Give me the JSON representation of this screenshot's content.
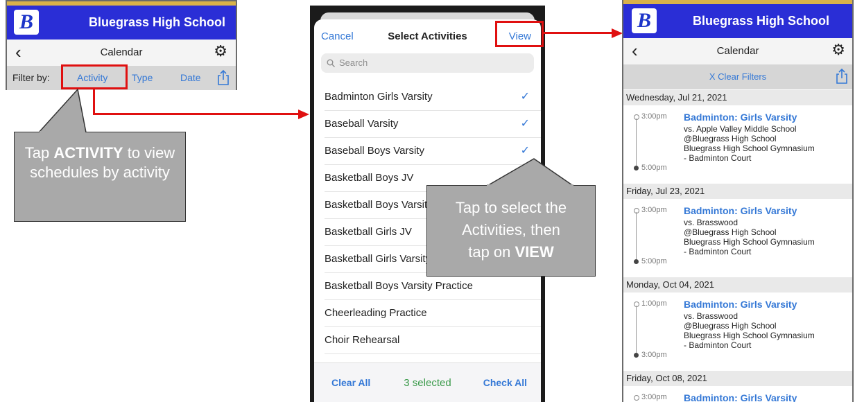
{
  "panel1": {
    "school_name": "Bluegrass High School",
    "logo_letter": "B",
    "nav_title": "Calendar",
    "filter_label": "Filter by:",
    "filter_activity": "Activity",
    "filter_type": "Type",
    "filter_date": "Date"
  },
  "callout1": {
    "pre": "Tap ",
    "bold": "ACTIVITY",
    "post": " to view schedules by activity"
  },
  "panel2": {
    "cancel": "Cancel",
    "title": "Select Activities",
    "view": "View",
    "search_placeholder": "Search",
    "items": [
      {
        "label": "Badminton Girls Varsity",
        "checked": true
      },
      {
        "label": "Baseball Varsity",
        "checked": true
      },
      {
        "label": "Baseball Boys Varsity",
        "checked": true
      },
      {
        "label": "Basketball Boys JV",
        "checked": false
      },
      {
        "label": "Basketball Boys Varsity",
        "checked": false
      },
      {
        "label": "Basketball Girls JV",
        "checked": false
      },
      {
        "label": "Basketball Girls Varsity",
        "checked": false
      },
      {
        "label": "Basketball Boys Varsity Practice",
        "checked": false
      },
      {
        "label": "Cheerleading Practice",
        "checked": false
      },
      {
        "label": "Choir Rehearsal",
        "checked": false
      }
    ],
    "clear_all": "Clear All",
    "selected_count": "3 selected",
    "check_all": "Check All",
    "check_glyph": "✓"
  },
  "callout2": {
    "line1": "Tap to select the",
    "line2": "Activities, then",
    "pre3": "tap on ",
    "bold3": "VIEW"
  },
  "panel3": {
    "school_name": "Bluegrass High School",
    "nav_title": "Calendar",
    "clear_filters": "X Clear Filters",
    "days": [
      {
        "date": "Wednesday, Jul 21, 2021",
        "start": "3:00pm",
        "end": "5:00pm",
        "title": "Badminton: Girls Varsity",
        "lines": [
          "vs. Apple Valley Middle School",
          "@Bluegrass High School",
          "Bluegrass High School Gymnasium",
          "- Badminton Court"
        ]
      },
      {
        "date": "Friday, Jul 23, 2021",
        "start": "3:00pm",
        "end": "5:00pm",
        "title": "Badminton: Girls Varsity",
        "lines": [
          "vs. Brasswood",
          "@Bluegrass High School",
          "Bluegrass High School Gymnasium",
          "- Badminton Court"
        ]
      },
      {
        "date": "Monday, Oct 04, 2021",
        "start": "1:00pm",
        "end": "3:00pm",
        "title": "Badminton: Girls Varsity",
        "lines": [
          "vs. Brasswood",
          "@Bluegrass High School",
          "Bluegrass High School Gymnasium",
          "- Badminton Court"
        ]
      },
      {
        "date": "Friday, Oct 08, 2021",
        "start": "3:00pm",
        "end": "",
        "title": "Badminton: Girls Varsity",
        "lines": []
      }
    ]
  },
  "icons": {
    "back": "chevron-left-icon",
    "settings": "gear-icon",
    "share": "share-icon",
    "search": "search-icon",
    "check": "checkmark-icon"
  },
  "colors": {
    "brand_blue": "#2a2ed6",
    "link_blue": "#3478d6",
    "highlight_red": "#e01010",
    "selected_green": "#3a9a4a"
  }
}
